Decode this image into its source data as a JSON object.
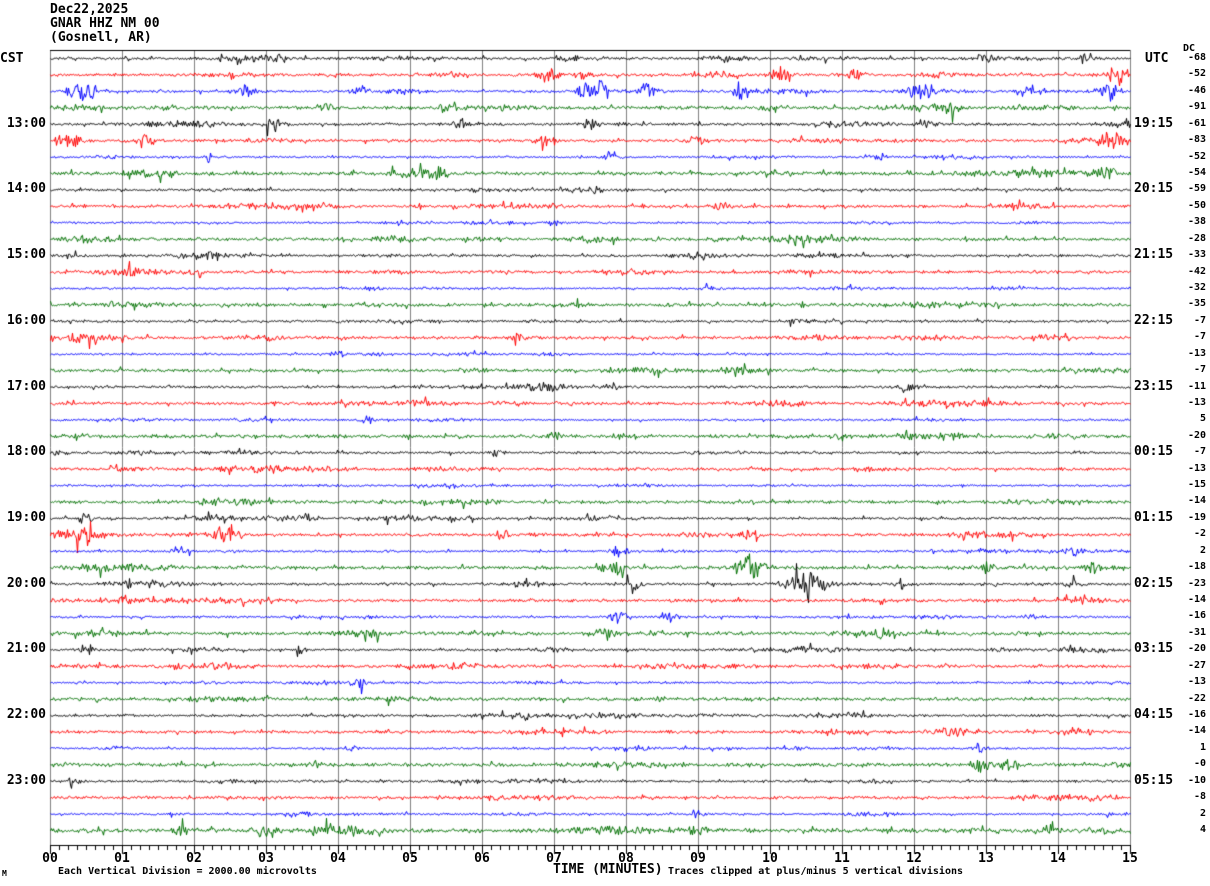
{
  "header": {
    "date": "Dec22,2025",
    "station": "GNAR HHZ NM 00",
    "location": "(Gosnell, AR)",
    "left_timezone": "CST",
    "right_timezone": "UTC",
    "dc_column_label": "DC"
  },
  "footer": {
    "corner_mark": "M",
    "scale_note": "Each Vertical Division = 2000.00 microvolts",
    "xaxis_label": "TIME (MINUTES)",
    "clip_note": "Traces clipped at plus/minus 5 vertical divisions"
  },
  "colors": {
    "black": "#000000",
    "red": "#ff0000",
    "blue": "#0000ff",
    "green": "#007000",
    "grid": "#808080",
    "axis": "#000000",
    "background": "#ffffff"
  },
  "chart_data": {
    "type": "line",
    "kind": "helicorder-seismogram",
    "title": "GNAR HHZ NM 00 (Gosnell, AR) Dec22,2025",
    "xlabel": "TIME (MINUTES)",
    "x_range_minutes": [
      0,
      15
    ],
    "x_ticks": [
      "00",
      "01",
      "02",
      "03",
      "04",
      "05",
      "06",
      "07",
      "08",
      "09",
      "10",
      "11",
      "12",
      "13",
      "14",
      "15"
    ],
    "minor_ticks_per_minute": 8,
    "minutes_per_line": 15,
    "trace_color_cycle": [
      "black",
      "red",
      "blue",
      "green"
    ],
    "left_axis_times_cst": [
      "13:00",
      "14:00",
      "15:00",
      "16:00",
      "17:00",
      "18:00",
      "19:00",
      "20:00",
      "21:00",
      "22:00",
      "23:00"
    ],
    "right_axis_times_utc": [
      "19:15",
      "20:15",
      "21:15",
      "22:15",
      "23:15",
      "00:15",
      "01:15",
      "02:15",
      "03:15",
      "04:15",
      "05:15"
    ],
    "rows": [
      {
        "color": "black",
        "cst": "",
        "utc": "",
        "dc": "-68",
        "amp": 1.0,
        "events": [
          [
            3.2,
            1.5
          ],
          [
            7.2,
            2
          ],
          [
            13.0,
            2.5
          ],
          [
            14.4,
            2
          ]
        ]
      },
      {
        "color": "red",
        "cst": "",
        "utc": "",
        "dc": "-52",
        "amp": 1.1,
        "events": [
          [
            6.9,
            2.5
          ],
          [
            7.4,
            2
          ],
          [
            10.15,
            3.5
          ],
          [
            11.2,
            2
          ],
          [
            14.8,
            3
          ]
        ]
      },
      {
        "color": "blue",
        "cst": "",
        "utc": "",
        "dc": "-46",
        "amp": 0.9,
        "events": [
          [
            0.45,
            4.5
          ],
          [
            2.7,
            2.5
          ],
          [
            4.3,
            2
          ],
          [
            7.55,
            5
          ],
          [
            8.3,
            3
          ],
          [
            9.6,
            2.5
          ],
          [
            12.1,
            4
          ],
          [
            13.6,
            2.5
          ],
          [
            14.7,
            3.5
          ]
        ]
      },
      {
        "color": "green",
        "cst": "",
        "utc": "",
        "dc": "-91",
        "amp": 1.3,
        "events": [
          [
            1.6,
            2
          ],
          [
            3.8,
            1.8
          ],
          [
            5.5,
            2
          ],
          [
            10.0,
            2
          ],
          [
            12.5,
            1.8
          ]
        ]
      },
      {
        "color": "black",
        "cst": "13:00",
        "utc": "19:15",
        "dc": "-61",
        "amp": 1.0,
        "events": [
          [
            3.1,
            2.5
          ],
          [
            5.7,
            1.8
          ],
          [
            7.5,
            2
          ],
          [
            10.9,
            1.8
          ],
          [
            12.2,
            1.8
          ]
        ]
      },
      {
        "color": "red",
        "cst": "",
        "utc": "",
        "dc": "-83",
        "amp": 1.1,
        "events": [
          [
            0.25,
            3.5
          ],
          [
            1.3,
            2.5
          ],
          [
            6.9,
            3
          ],
          [
            9.0,
            2
          ],
          [
            14.75,
            3
          ]
        ]
      },
      {
        "color": "blue",
        "cst": "",
        "utc": "",
        "dc": "-52",
        "amp": 0.7,
        "events": [
          [
            2.2,
            1.5
          ],
          [
            7.8,
            1.5
          ],
          [
            11.5,
            1.5
          ]
        ]
      },
      {
        "color": "green",
        "cst": "",
        "utc": "",
        "dc": "-54",
        "amp": 1.3,
        "events": [
          [
            1.6,
            1.8
          ],
          [
            5.4,
            1.8
          ],
          [
            10.0,
            1.8
          ],
          [
            14.65,
            2.5
          ]
        ]
      },
      {
        "color": "black",
        "cst": "14:00",
        "utc": "20:15",
        "dc": "-59",
        "amp": 0.9,
        "events": []
      },
      {
        "color": "red",
        "cst": "",
        "utc": "",
        "dc": "-50",
        "amp": 1.1,
        "events": [
          [
            9.3,
            1.5
          ]
        ]
      },
      {
        "color": "blue",
        "cst": "",
        "utc": "",
        "dc": "-38",
        "amp": 0.7,
        "events": [
          [
            7.0,
            1.3
          ]
        ]
      },
      {
        "color": "green",
        "cst": "",
        "utc": "",
        "dc": "-28",
        "amp": 1.2,
        "events": []
      },
      {
        "color": "black",
        "cst": "15:00",
        "utc": "21:15",
        "dc": "-33",
        "amp": 0.9,
        "events": [
          [
            0.3,
            1.5
          ]
        ]
      },
      {
        "color": "red",
        "cst": "",
        "utc": "",
        "dc": "-42",
        "amp": 1.1,
        "events": [
          [
            2.0,
            1.3
          ]
        ]
      },
      {
        "color": "blue",
        "cst": "",
        "utc": "",
        "dc": "-32",
        "amp": 0.7,
        "events": [
          [
            4.5,
            1.2
          ]
        ]
      },
      {
        "color": "green",
        "cst": "",
        "utc": "",
        "dc": "-35",
        "amp": 1.2,
        "events": []
      },
      {
        "color": "black",
        "cst": "16:00",
        "utc": "22:15",
        "dc": "-7",
        "amp": 0.9,
        "events": []
      },
      {
        "color": "red",
        "cst": "",
        "utc": "",
        "dc": "-7",
        "amp": 1.1,
        "events": [
          [
            6.5,
            1.3
          ]
        ]
      },
      {
        "color": "blue",
        "cst": "",
        "utc": "",
        "dc": "-13",
        "amp": 0.7,
        "events": [
          [
            4.0,
            1.2
          ]
        ]
      },
      {
        "color": "green",
        "cst": "",
        "utc": "",
        "dc": "-7",
        "amp": 1.2,
        "events": [
          [
            9.5,
            1.5
          ]
        ]
      },
      {
        "color": "black",
        "cst": "17:00",
        "utc": "23:15",
        "dc": "-11",
        "amp": 0.9,
        "events": [
          [
            7.8,
            1.5
          ],
          [
            11.9,
            1.8
          ]
        ]
      },
      {
        "color": "red",
        "cst": "",
        "utc": "",
        "dc": "-13",
        "amp": 1.1,
        "events": []
      },
      {
        "color": "blue",
        "cst": "",
        "utc": "",
        "dc": "5",
        "amp": 0.7,
        "events": [
          [
            4.4,
            1.3
          ]
        ]
      },
      {
        "color": "green",
        "cst": "",
        "utc": "",
        "dc": "-20",
        "amp": 1.3,
        "events": [
          [
            7.0,
            1.6
          ],
          [
            11.0,
            1.5
          ]
        ]
      },
      {
        "color": "black",
        "cst": "18:00",
        "utc": "00:15",
        "dc": "-7",
        "amp": 0.9,
        "events": [
          [
            6.2,
            1.4
          ]
        ]
      },
      {
        "color": "red",
        "cst": "",
        "utc": "",
        "dc": "-13",
        "amp": 1.1,
        "events": []
      },
      {
        "color": "blue",
        "cst": "",
        "utc": "",
        "dc": "-15",
        "amp": 0.7,
        "events": []
      },
      {
        "color": "green",
        "cst": "",
        "utc": "",
        "dc": "-14",
        "amp": 1.2,
        "events": []
      },
      {
        "color": "black",
        "cst": "19:00",
        "utc": "01:15",
        "dc": "-19",
        "amp": 0.9,
        "events": [
          [
            0.5,
            1.5
          ]
        ]
      },
      {
        "color": "red",
        "cst": "",
        "utc": "",
        "dc": "-2",
        "amp": 1.1,
        "events": [
          [
            0.4,
            2
          ],
          [
            2.5,
            3.5
          ],
          [
            6.3,
            1.8
          ],
          [
            9.7,
            2
          ]
        ]
      },
      {
        "color": "blue",
        "cst": "",
        "utc": "",
        "dc": "2",
        "amp": 0.8,
        "events": [
          [
            1.8,
            2
          ],
          [
            7.9,
            1.8
          ],
          [
            14.2,
            1.5
          ]
        ]
      },
      {
        "color": "green",
        "cst": "",
        "utc": "",
        "dc": "-18",
        "amp": 1.3,
        "events": [
          [
            7.8,
            3
          ],
          [
            9.7,
            4.5
          ],
          [
            13.0,
            2
          ],
          [
            14.5,
            2
          ]
        ]
      },
      {
        "color": "black",
        "cst": "20:00",
        "utc": "02:15",
        "dc": "-23",
        "amp": 1.0,
        "events": [
          [
            8.1,
            2
          ],
          [
            10.5,
            7
          ],
          [
            11.8,
            1.8
          ],
          [
            14.2,
            1.5
          ]
        ]
      },
      {
        "color": "red",
        "cst": "",
        "utc": "",
        "dc": "-14",
        "amp": 1.1,
        "events": [
          [
            1.0,
            1.4
          ]
        ]
      },
      {
        "color": "blue",
        "cst": "",
        "utc": "",
        "dc": "-16",
        "amp": 0.8,
        "events": [
          [
            7.9,
            2.5
          ],
          [
            8.6,
            1.8
          ]
        ]
      },
      {
        "color": "green",
        "cst": "",
        "utc": "",
        "dc": "-31",
        "amp": 1.3,
        "events": [
          [
            7.7,
            2.5
          ],
          [
            8.4,
            2.2
          ],
          [
            11.5,
            1.6
          ]
        ]
      },
      {
        "color": "black",
        "cst": "21:00",
        "utc": "03:15",
        "dc": "-20",
        "amp": 0.9,
        "events": [
          [
            0.5,
            2
          ],
          [
            3.5,
            1.4
          ]
        ]
      },
      {
        "color": "red",
        "cst": "",
        "utc": "",
        "dc": "-27",
        "amp": 1.1,
        "events": []
      },
      {
        "color": "blue",
        "cst": "",
        "utc": "",
        "dc": "-13",
        "amp": 0.7,
        "events": [
          [
            4.3,
            1.3
          ]
        ]
      },
      {
        "color": "green",
        "cst": "",
        "utc": "",
        "dc": "-22",
        "amp": 1.2,
        "events": []
      },
      {
        "color": "black",
        "cst": "22:00",
        "utc": "04:15",
        "dc": "-16",
        "amp": 0.9,
        "events": []
      },
      {
        "color": "red",
        "cst": "",
        "utc": "",
        "dc": "-14",
        "amp": 1.1,
        "events": []
      },
      {
        "color": "blue",
        "cst": "",
        "utc": "",
        "dc": "1",
        "amp": 0.7,
        "events": [
          [
            4.2,
            1.3
          ],
          [
            12.9,
            1.6
          ]
        ]
      },
      {
        "color": "green",
        "cst": "",
        "utc": "",
        "dc": "-0",
        "amp": 1.3,
        "events": [
          [
            3.7,
            1.6
          ],
          [
            12.9,
            2.5
          ],
          [
            13.3,
            2
          ]
        ]
      },
      {
        "color": "black",
        "cst": "23:00",
        "utc": "05:15",
        "dc": "-10",
        "amp": 0.9,
        "events": [
          [
            0.3,
            1.6
          ]
        ]
      },
      {
        "color": "red",
        "cst": "",
        "utc": "",
        "dc": "-8",
        "amp": 1.1,
        "events": []
      },
      {
        "color": "blue",
        "cst": "",
        "utc": "",
        "dc": "2",
        "amp": 0.7,
        "events": [
          [
            9.0,
            1.3
          ]
        ]
      },
      {
        "color": "green",
        "cst": "",
        "utc": "",
        "dc": "4",
        "amp": 1.6,
        "events": [
          [
            1.8,
            1.8
          ],
          [
            2.9,
            1.8
          ],
          [
            4.1,
            1.8
          ],
          [
            9.0,
            2.2
          ],
          [
            13.9,
            1.8
          ]
        ]
      }
    ]
  }
}
